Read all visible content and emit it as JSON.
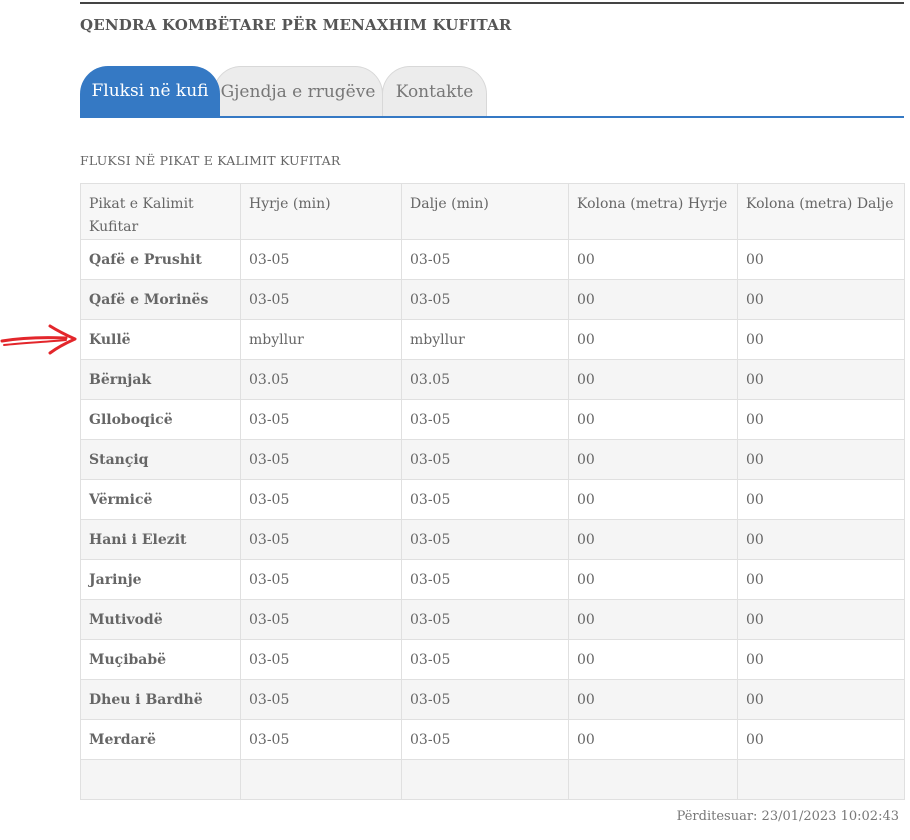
{
  "header": {
    "title": "QENDRA KOMBËTARE PËR MENAXHIM KUFITAR"
  },
  "tabs": [
    {
      "label": "Fluksi në kufi",
      "active": true
    },
    {
      "label": "Gjendja e rrugëve",
      "active": false
    },
    {
      "label": "Kontakte",
      "active": false
    }
  ],
  "section": {
    "title": "FLUKSI NË PIKAT E KALIMIT KUFITAR"
  },
  "table": {
    "headers": [
      "Pikat e Kalimit Kufitar",
      "Hyrje (min)",
      "Dalje (min)",
      "Kolona (metra) Hyrje",
      "Kolona (metra) Dalje"
    ],
    "rows": [
      [
        "Qafë e Prushit",
        "03-05",
        "03-05",
        "00",
        "00"
      ],
      [
        "Qafë e Morinës",
        "03-05",
        "03-05",
        "00",
        "00"
      ],
      [
        "Kullë",
        "mbyllur",
        "mbyllur",
        "00",
        "00"
      ],
      [
        "Bërnjak",
        "03.05",
        "03.05",
        "00",
        "00"
      ],
      [
        "Glloboqicë",
        "03-05",
        "03-05",
        "00",
        "00"
      ],
      [
        "Stançiq",
        "03-05",
        "03-05",
        "00",
        "00"
      ],
      [
        "Vërmicë",
        "03-05",
        "03-05",
        "00",
        "00"
      ],
      [
        "Hani i Elezit",
        "03-05",
        "03-05",
        "00",
        "00"
      ],
      [
        "Jarinje",
        "03-05",
        "03-05",
        "00",
        "00"
      ],
      [
        "Mutivodë",
        "03-05",
        "03-05",
        "00",
        "00"
      ],
      [
        "Muçibabë",
        "03-05",
        "03-05",
        "00",
        "00"
      ],
      [
        "Dheu i Bardhë",
        "03-05",
        "03-05",
        "00",
        "00"
      ],
      [
        "Merdarë",
        "03-05",
        "03-05",
        "00",
        "00"
      ]
    ]
  },
  "footer": {
    "updated": "Përditesuar: 23/01/2023 10:02:43"
  },
  "colors": {
    "accent": "#3579c4",
    "annotation_arrow": "#e3262b"
  },
  "icons": {
    "annotation": "arrow-right-icon"
  }
}
